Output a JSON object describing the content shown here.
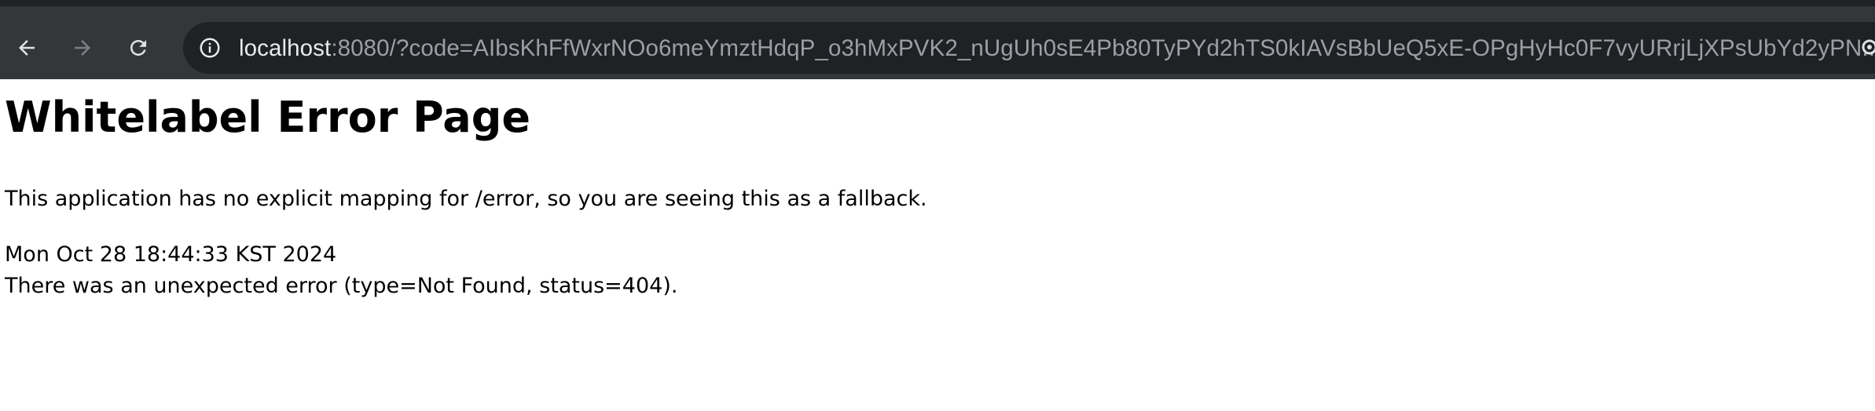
{
  "browser": {
    "url_host": "localhost",
    "url_rest": ":8080/?code=AIbsKhFfWxrNOo6meYmztHdqP_o3hMxPVK2_nUgUh0sE4Pb80TyPYd2hTS0kIAVsBbUeQ5xE-OPgHyHc0F7vyURrjLjXPsUbYd2yPN...",
    "icons": [
      "back-arrow-icon",
      "forward-arrow-icon",
      "reload-icon",
      "info-icon",
      "extension-icon"
    ],
    "colors": {
      "toolbar": "#35363a",
      "omnibox": "#202124",
      "url_host": "#e8eaed",
      "url_rest": "#9aa0a6"
    }
  },
  "page": {
    "title": "Whitelabel Error Page",
    "message": "This application has no explicit mapping for /error, so you are seeing this as a fallback.",
    "timestamp": "Mon Oct 28 18:44:33 KST 2024",
    "error": "There was an unexpected error (type=Not Found, status=404)."
  }
}
